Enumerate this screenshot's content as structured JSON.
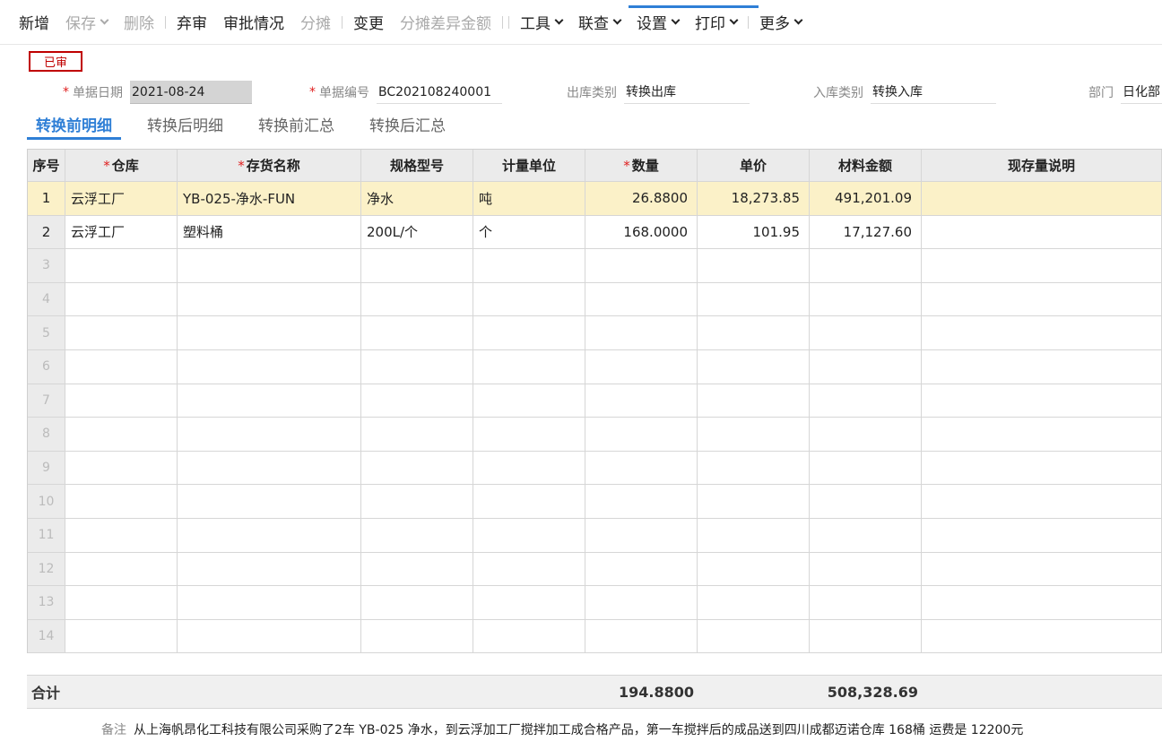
{
  "toolbar": {
    "items": [
      {
        "label": "新增",
        "state": "enabled",
        "dropdown": false
      },
      {
        "label": "保存",
        "state": "disabled",
        "dropdown": true
      },
      {
        "label": "删除",
        "state": "disabled",
        "dropdown": false
      },
      {
        "label": "弃审",
        "state": "enabled",
        "dropdown": false
      },
      {
        "label": "审批情况",
        "state": "enabled",
        "dropdown": false
      },
      {
        "label": "分摊",
        "state": "disabled",
        "dropdown": false
      },
      {
        "label": "变更",
        "state": "enabled",
        "dropdown": false
      },
      {
        "label": "分摊差异金额",
        "state": "disabled",
        "dropdown": false
      },
      {
        "label": "工具",
        "state": "enabled",
        "dropdown": true
      },
      {
        "label": "联查",
        "state": "enabled",
        "dropdown": true
      },
      {
        "label": "设置",
        "state": "enabled",
        "dropdown": true
      },
      {
        "label": "打印",
        "state": "enabled",
        "dropdown": true
      },
      {
        "label": "更多",
        "state": "enabled",
        "dropdown": true
      }
    ]
  },
  "status_badge": "已审",
  "header": {
    "date_label": "单据日期",
    "date_value": "2021-08-24",
    "number_label": "单据编号",
    "number_value": "BC202108240001",
    "out_type_label": "出库类别",
    "out_type_value": "转换出库",
    "in_type_label": "入库类别",
    "in_type_value": "转换入库",
    "dept_label": "部门",
    "dept_value": "日化部"
  },
  "tabs": [
    {
      "label": "转换前明细",
      "active": true
    },
    {
      "label": "转换后明细",
      "active": false
    },
    {
      "label": "转换前汇总",
      "active": false
    },
    {
      "label": "转换后汇总",
      "active": false
    }
  ],
  "table": {
    "columns": [
      {
        "label": "序号",
        "required": false
      },
      {
        "label": "仓库",
        "required": true
      },
      {
        "label": "存货名称",
        "required": true
      },
      {
        "label": "规格型号",
        "required": false
      },
      {
        "label": "计量单位",
        "required": false
      },
      {
        "label": "数量",
        "required": true
      },
      {
        "label": "单价",
        "required": false
      },
      {
        "label": "材料金额",
        "required": false
      },
      {
        "label": "现存量说明",
        "required": false
      }
    ],
    "rows": [
      {
        "seq": "1",
        "warehouse": "云浮工厂",
        "item": "YB-025-净水-FUN",
        "spec": "净水",
        "unit": "吨",
        "qty": "26.8800",
        "price": "18,273.85",
        "amount": "491,201.09",
        "stock_note": ""
      },
      {
        "seq": "2",
        "warehouse": "云浮工厂",
        "item": "塑料桶",
        "spec": "200L/个",
        "unit": "个",
        "qty": "168.0000",
        "price": "101.95",
        "amount": "17,127.60",
        "stock_note": ""
      }
    ],
    "empty_row_numbers": [
      "3",
      "4",
      "5",
      "6",
      "7",
      "8",
      "9",
      "10",
      "11",
      "12",
      "13",
      "14"
    ]
  },
  "totals": {
    "label": "合计",
    "qty": "194.8800",
    "amount": "508,328.69"
  },
  "remark": {
    "label": "备注",
    "value": "从上海帆昂化工科技有限公司采购了2车 YB-025 净水，到云浮加工厂搅拌加工成合格产品，第一车搅拌后的成品送到四川成都迈诺仓库  168桶  运费是 12200元"
  },
  "colors": {
    "accent": "#2f7fd6",
    "required": "#e02020",
    "badge": "#c00000",
    "selected_row": "#fbf1c8"
  }
}
